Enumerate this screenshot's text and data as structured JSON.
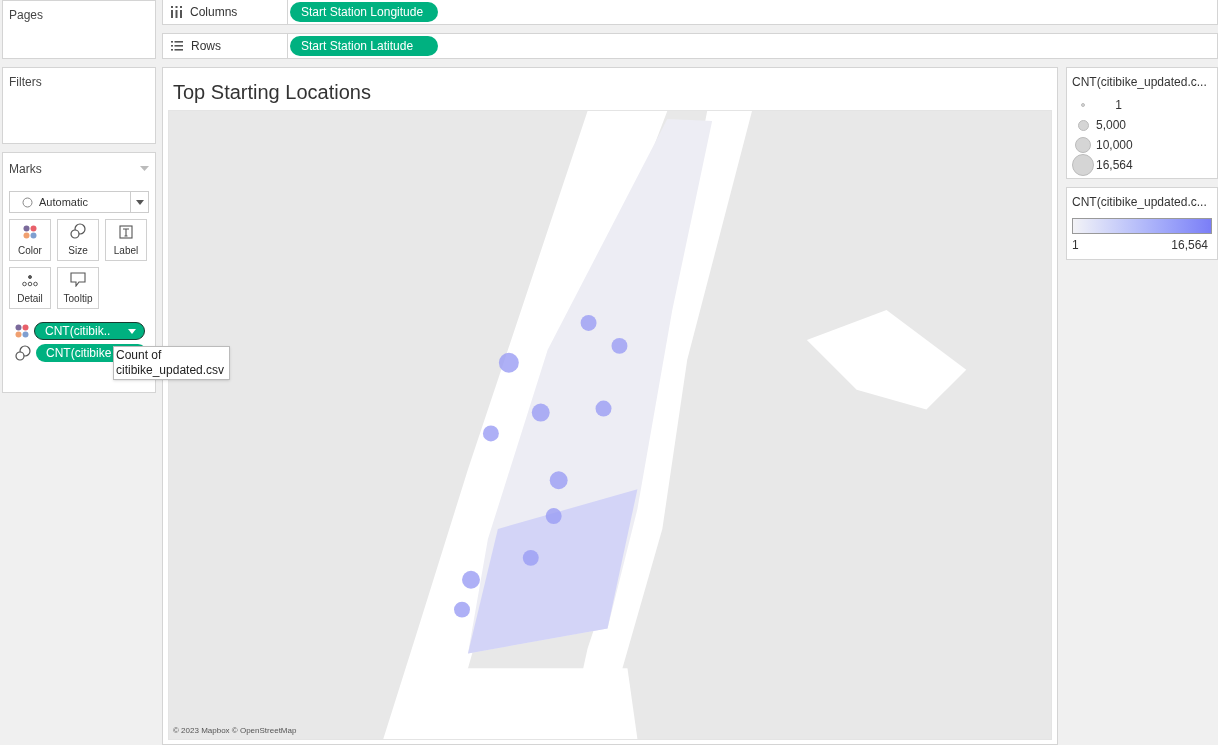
{
  "left_panel": {
    "pages": {
      "title": "Pages"
    },
    "filters": {
      "title": "Filters"
    },
    "marks": {
      "title": "Marks",
      "mark_type": "Automatic",
      "cards": [
        {
          "kind": "color",
          "label": "Color"
        },
        {
          "kind": "size",
          "label": "Size"
        },
        {
          "kind": "label",
          "label": "Label"
        },
        {
          "kind": "detail",
          "label": "Detail"
        },
        {
          "kind": "tooltip",
          "label": "Tooltip"
        }
      ],
      "fields": [
        {
          "kind": "color",
          "label": "CNT(citibik..",
          "menu": true
        },
        {
          "kind": "size",
          "label": "CNT(citibike",
          "menu": false
        }
      ],
      "tooltip": "Count of citibike_updated.csv"
    }
  },
  "shelves": [
    {
      "kind": "columns",
      "label": "Columns",
      "pills": [
        "Start Station Longitude"
      ]
    },
    {
      "kind": "rows",
      "label": "Rows",
      "pills": [
        "Start Station Latitude"
      ]
    }
  ],
  "view": {
    "title": "Top Starting Locations",
    "attribution": "© 2023 Mapbox © OpenStreetMap"
  },
  "legends": [
    {
      "kind": "size",
      "title": "CNT(citibike_updated.c...",
      "items": [
        "1",
        "5,000",
        "10,000",
        "16,564"
      ]
    },
    {
      "kind": "color",
      "title": "CNT(citibike_updated.c...",
      "min": "1",
      "max": "16,564"
    }
  ]
}
